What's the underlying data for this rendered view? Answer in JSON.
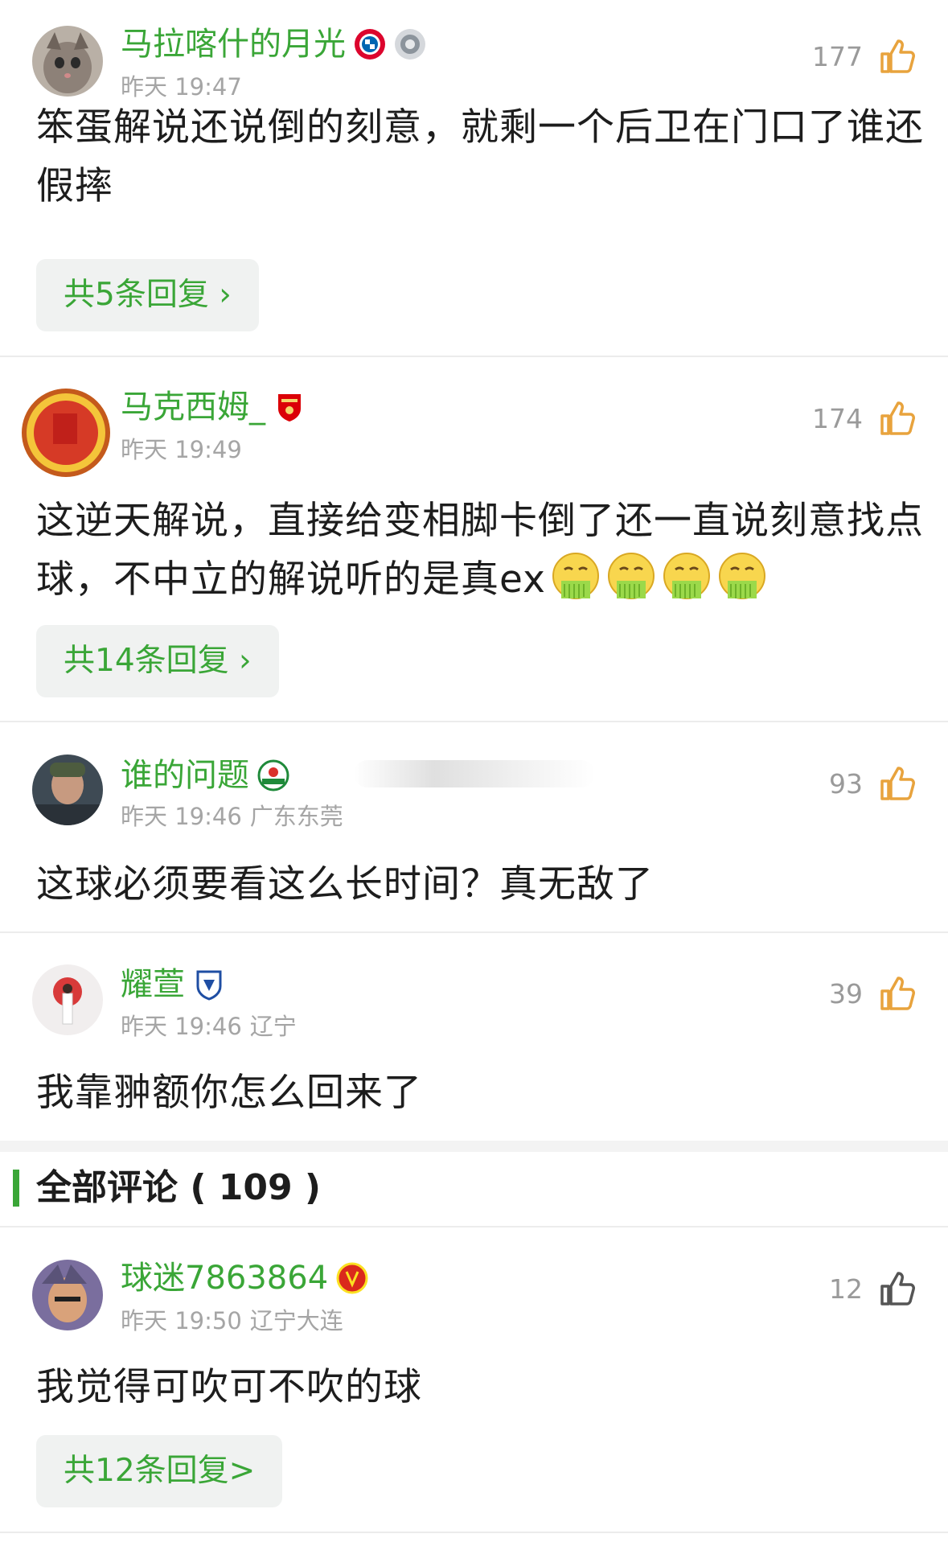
{
  "comments": [
    {
      "username": "马拉喀什的月光",
      "time": "昨天 19:47",
      "location": "",
      "likes": "177",
      "content": "笨蛋解说还说倒的刻意，就剩一个后卫在门口了谁还假摔",
      "replies": "共5条回复 ›",
      "badges": [
        "bayern-munich-badge",
        "trophy-badge"
      ]
    },
    {
      "username": "马克西姆_",
      "time": "昨天 19:49",
      "location": "",
      "likes": "174",
      "content": "这逆天解说，直接给变相脚卡倒了还一直说刻意找点球，不中立的解说听的是真ex",
      "emoji_count": 4,
      "replies": "共14条回复 ›",
      "badges": [
        "arsenal-badge"
      ]
    },
    {
      "username": "谁的问题",
      "time": "昨天 19:46",
      "location": "广东东莞",
      "likes": "93",
      "content": "这球必须要看这么长时间？真无敌了",
      "badges": [
        "henan-badge"
      ]
    },
    {
      "username": "耀萱",
      "time": "昨天 19:46",
      "location": "辽宁",
      "likes": "39",
      "content": "我靠翀额你怎么回来了",
      "badges": [
        "dalian-badge"
      ]
    },
    {
      "username": "球迷7863864",
      "time": "昨天 19:50",
      "location": "辽宁大连",
      "likes": "12",
      "content": "我觉得可吹可不吹的球",
      "replies": "共12条回复>",
      "badges": [
        "manchester-united-badge"
      ]
    }
  ],
  "section": {
    "title": "全部评论 ( 109 )"
  },
  "colors": {
    "accent": "#3aa637",
    "text": "#1d1d1d",
    "meta": "#a5a5a5",
    "like": "#e8a33d"
  }
}
